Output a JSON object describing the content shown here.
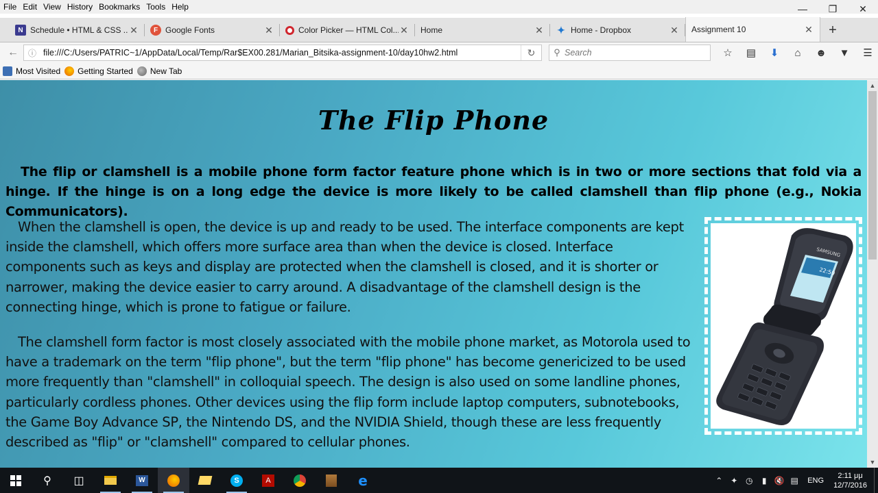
{
  "menu": [
    "File",
    "Edit",
    "View",
    "History",
    "Bookmarks",
    "Tools",
    "Help"
  ],
  "tabs": [
    {
      "title": "Schedule • HTML & CSS ...",
      "favicon": "onenote-icon",
      "color": "#3b3b8f",
      "glyph": "N"
    },
    {
      "title": "Google Fonts",
      "favicon": "google-fonts-icon",
      "color": "#e0533b",
      "glyph": "F"
    },
    {
      "title": "Color Picker — HTML Col...",
      "favicon": "opera-icon",
      "color": "#d0262e",
      "glyph": "O"
    },
    {
      "title": "Home",
      "favicon": "",
      "color": "",
      "glyph": ""
    },
    {
      "title": "Home - Dropbox",
      "favicon": "dropbox-icon",
      "color": "#1f78d1",
      "glyph": "✦"
    },
    {
      "title": "Assignment 10",
      "favicon": "",
      "color": "",
      "glyph": "",
      "active": true
    }
  ],
  "url": "file:///C:/Users/PATRIC~1/AppData/Local/Temp/Rar$EX00.281/Marian_Bitsika-assignment-10/day10hw2.html",
  "search": {
    "placeholder": "Search"
  },
  "bookmarks": [
    {
      "label": "Most Visited",
      "icon": "most-visited-icon",
      "color": "#3d6fb4"
    },
    {
      "label": "Getting Started",
      "icon": "firefox-icon",
      "color": "#e66000"
    },
    {
      "label": "New Tab",
      "icon": "globe-icon",
      "color": "#777777"
    }
  ],
  "page": {
    "title": "The Flip Phone",
    "intro": "The flip or clamshell is a mobile phone form factor feature phone which is in two or more sections that fold via a hinge. If the hinge is on a long edge the device is more likely to be called clamshell than flip phone (e.g., Nokia Communicators).",
    "para1": "When the clamshell is open, the device is up and ready to be used. The interface components are kept inside the clamshell, which offers more surface area than when the device is closed. Interface components such as keys and display are protected when the clamshell is closed, and it is shorter or narrower, making the device easier to carry around. A disadvantage of the clamshell design is the connecting hinge, which is prone to fatigue or failure.",
    "para2": "The clamshell form factor is most closely associated with the mobile phone market, as Motorola used to have a trademark on the term \"flip phone\", but the term \"flip phone\" has become genericized to be used more frequently than \"clamshell\" in colloquial speech. The design is also used on some landline phones, particularly cordless phones. Other devices using the flip form include laptop computers, subnotebooks, the Game Boy Advance SP, the Nintendo DS, and the NVIDIA Shield, though these are less frequently described as \"flip\" or \"clamshell\" compared to cellular phones.",
    "phone_brand": "SAMSUNG",
    "phone_time": "22:50"
  },
  "taskbar": {
    "lang": "ENG",
    "time": "2:11 μμ",
    "date": "12/7/2016"
  }
}
